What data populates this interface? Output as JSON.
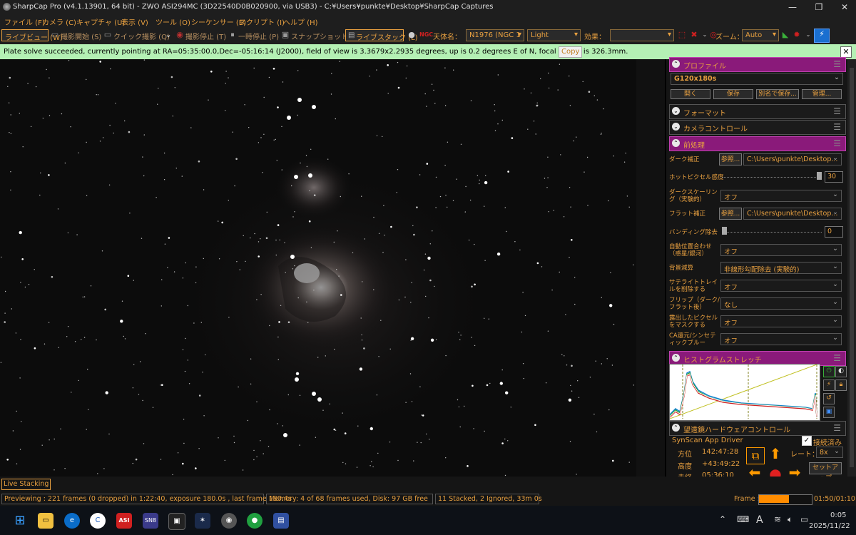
{
  "window": {
    "title": "SharpCap Pro (v4.1.13901, 64 bit) - ZWO ASI294MC (3D22540D0B020900, via USB3) - C:¥Users¥punkte¥Desktop¥SharpCap Captures",
    "minimize": "—",
    "maximize": "❐",
    "close": "✕"
  },
  "menu": [
    "ファイル (F)",
    "カメラ (C)",
    "キャプチャ (U)",
    "表示 (V)",
    "ツール (O)",
    "シーケンサー (E)",
    "スクリプト (I)",
    "ヘルプ (H)"
  ],
  "toolbar": {
    "liveview": "ライブビュー (W)",
    "start_capture": "撮影開始 (S)",
    "quick_capture": "クイック撮影 (Q)",
    "stop_capture": "撮影停止 (T)",
    "pause": "一時停止 (P)",
    "snapshot": "スナップショット (A)",
    "live_stack": "ライブスタック (L)",
    "target_label": "天体名：",
    "target_value": "N1976 (NGC 1",
    "frame_type": "Light",
    "effect_label": "効果：",
    "effect_value": "",
    "zoom_label": "ズーム：",
    "zoom_value": "Auto"
  },
  "notification": {
    "message": "Plate solve succeeded, currently pointing at RA=05:35:00.0,Dec=-05:16:14 (J2000), field of view is 3.3679x2.2935 degrees, up is 0.2 degrees E of N, focal length is 326.3mm.",
    "copy": "Copy",
    "close": "✕"
  },
  "panel": {
    "profile": {
      "header": "プロファイル",
      "value": "G120x180s",
      "buttons": [
        "開く",
        "保存",
        "別名で保存...",
        "管理..."
      ]
    },
    "format_header": "フォーマット",
    "camera_header": "カメラコントロール",
    "preprocess": {
      "header": "前処理",
      "dark_label": "ダーク補正",
      "browse": "参照...",
      "dark_path": "C:\\Users\\punkte\\Desktop...",
      "hotpixel_label": "ホットピクセル感度",
      "hotpixel_value": "30",
      "hotpixel_level": 1.0,
      "darkscale_label": "ダークスケーリング（実験的）",
      "darkscale_value": "オフ",
      "flat_label": "フラット補正",
      "flat_path": "C:\\Users\\punkte\\Desktop...",
      "banding_label": "バンディング除去",
      "banding_value": "0",
      "banding_level": 0.0,
      "autoalign_label": "自動位置合わせ（惑星/銀河）",
      "autoalign_value": "オフ",
      "bg_label": "背景減算",
      "bg_value": "非線形勾配除去 (実験的)",
      "sat_label": "サテライトトレイルを削除する",
      "sat_value": "オフ",
      "flip_label": "フリップ（ダーク/フラット後）",
      "flip_value": "なし",
      "overexp_label": "露出したピクセルをマスクする",
      "overexp_value": "オフ",
      "ca_label": "CA還元/シンセティックブルー",
      "ca_value": "オフ"
    },
    "histogram_header": "ヒストグラムストレッチ",
    "telescope": {
      "header": "望遠鏡ハードウェアコントロール",
      "driver": "SynScan App Driver",
      "connected": "接続済み",
      "azimuth_label": "方位",
      "azimuth": "142:47:28",
      "altitude_label": "高度",
      "altitude": "+43:49:22",
      "third_label": "赤経",
      "third": "05:36:10",
      "rate_label": "レート：",
      "rate": "8x",
      "setup": "セットアップ"
    }
  },
  "bottom": {
    "live_stacking": "Live Stacking",
    "previewing": "Previewing : 221 frames (0 dropped) in 1:22:40, exposure 180.0s , last frame 180.4s",
    "memory": "Memory: 4 of 68 frames used, Disk: 97 GB free",
    "stacked": "11 Stacked, 2 Ignored, 33m 0s",
    "frame_label": "Frame :",
    "frame_progress": 0.58,
    "frame_time": "01:50/01:10"
  },
  "taskbar": {
    "time": "0:05",
    "date": "2025/11/22",
    "apps": [
      "windows-start",
      "file-explorer",
      "edge",
      "ccleaner",
      "asi-studio",
      "sn8",
      "app-box",
      "astrometry",
      "sharpcap",
      "app-green",
      "app-remote"
    ],
    "ime": "A"
  },
  "colors": {
    "accent": "#e8a040",
    "section_highlight": "#8a1a7a",
    "notice_bg": "#b4f0b4"
  }
}
